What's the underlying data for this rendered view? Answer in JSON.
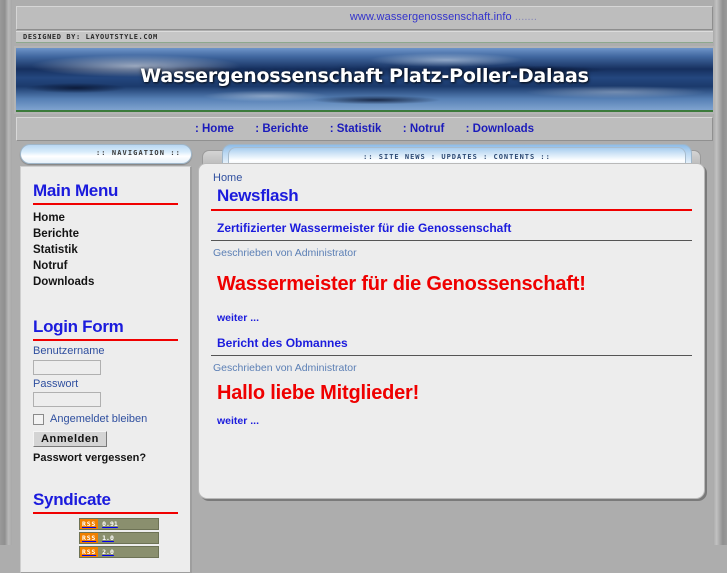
{
  "site": {
    "url_text": "www.wassergenossenschaft.info",
    "url_dots": " .......",
    "designed_by": "DESIGNED BY: LAYOUTSTYLE.COM",
    "banner_title": "Wassergenossenschaft Platz-Poller-Dalaas"
  },
  "topnav": {
    "items": [
      {
        "label": ": Home"
      },
      {
        "label": ": Berichte"
      },
      {
        "label": ": Statistik"
      },
      {
        "label": ": Notruf"
      },
      {
        "label": ": Downloads"
      }
    ]
  },
  "sidebar": {
    "tab_label": ":: NAVIGATION ::",
    "main_menu": {
      "title": "Main Menu",
      "items": [
        {
          "label": "Home"
        },
        {
          "label": "Berichte"
        },
        {
          "label": "Statistik"
        },
        {
          "label": "Notruf"
        },
        {
          "label": "Downloads"
        }
      ]
    },
    "login": {
      "title": "Login Form",
      "username_label": "Benutzername",
      "username_value": "",
      "password_label": "Passwort",
      "password_value": "",
      "remember_label": "Angemeldet bleiben",
      "submit_label": "Anmelden",
      "forgot_label": "Passwort vergessen?"
    },
    "syndicate": {
      "title": "Syndicate",
      "feeds": [
        {
          "tag": "RSS",
          "version": "0.91"
        },
        {
          "tag": "RSS",
          "version": "1.0"
        },
        {
          "tag": "RSS",
          "version": "2.0"
        }
      ]
    }
  },
  "content": {
    "tab_label": ":: SITE NEWS : UPDATES : CONTENTS ::",
    "breadcrumb": "Home",
    "page_title": "Newsflash",
    "articles": [
      {
        "title": "Zertifizierter Wassermeister für die Genossenschaft",
        "meta": "Geschrieben von Administrator",
        "lead": "Wassermeister für die Genossenschaft!",
        "more": "weiter ..."
      },
      {
        "title": "Bericht des Obmannes",
        "meta": "Geschrieben von Administrator",
        "lead": "Hallo liebe Mitglieder!",
        "more": "weiter ..."
      }
    ]
  },
  "colors": {
    "page_bg": "#adadad",
    "panel_bg": "#ededed",
    "link_blue": "#1b1bdd",
    "accent_red": "#f00000",
    "rss_orange": "#f08000"
  }
}
